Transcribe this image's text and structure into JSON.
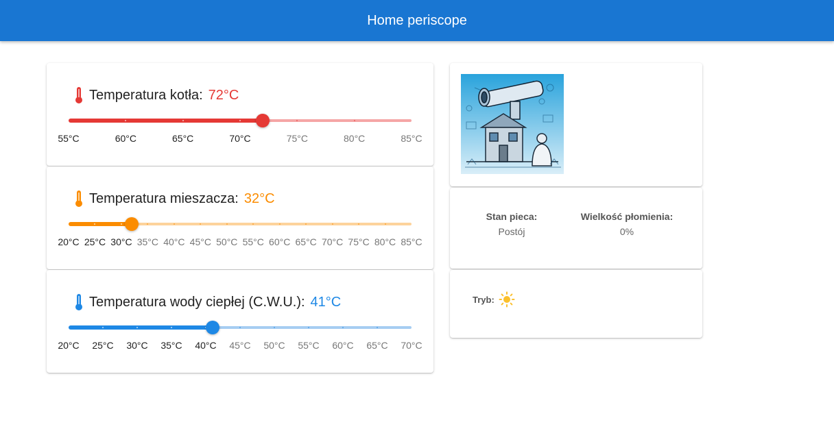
{
  "header": {
    "title": "Home periscope"
  },
  "sliders": [
    {
      "label": "Temperatura kotła:",
      "value_text": "72°C",
      "value": 72,
      "min": 55,
      "max": 85,
      "marks": [
        "55°C",
        "60°C",
        "65°C",
        "70°C",
        "75°C",
        "80°C",
        "85°C"
      ],
      "mark_values": [
        55,
        60,
        65,
        70,
        75,
        80,
        85
      ],
      "color": "#e53935",
      "rail_color": "#f5a6a6"
    },
    {
      "label": "Temperatura mieszacza:",
      "value_text": "32°C",
      "value": 32,
      "min": 20,
      "max": 85,
      "marks": [
        "20°C",
        "25°C",
        "30°C",
        "35°C",
        "40°C",
        "45°C",
        "50°C",
        "55°C",
        "60°C",
        "65°C",
        "70°C",
        "75°C",
        "80°C",
        "85°C"
      ],
      "mark_values": [
        20,
        25,
        30,
        35,
        40,
        45,
        50,
        55,
        60,
        65,
        70,
        75,
        80,
        85
      ],
      "color": "#fb8c00",
      "rail_color": "#fdd39c"
    },
    {
      "label": "Temperatura wody ciepłej (C.W.U.):",
      "value_text": "41°C",
      "value": 41,
      "min": 20,
      "max": 70,
      "marks": [
        "20°C",
        "25°C",
        "30°C",
        "35°C",
        "40°C",
        "45°C",
        "50°C",
        "55°C",
        "60°C",
        "65°C",
        "70°C"
      ],
      "mark_values": [
        20,
        25,
        30,
        35,
        40,
        45,
        50,
        55,
        60,
        65,
        70
      ],
      "color": "#1e88e5",
      "rail_color": "#a6cdf2"
    }
  ],
  "status": {
    "stove_label": "Stan pieca:",
    "stove_value": "Postój",
    "flame_label": "Wielkość płomienia:",
    "flame_value": "0%"
  },
  "mode": {
    "label": "Tryb:",
    "icon": "sun-icon",
    "icon_color": "#fbc02d"
  },
  "illustration": {
    "icon": "periscope-house-illustration"
  }
}
